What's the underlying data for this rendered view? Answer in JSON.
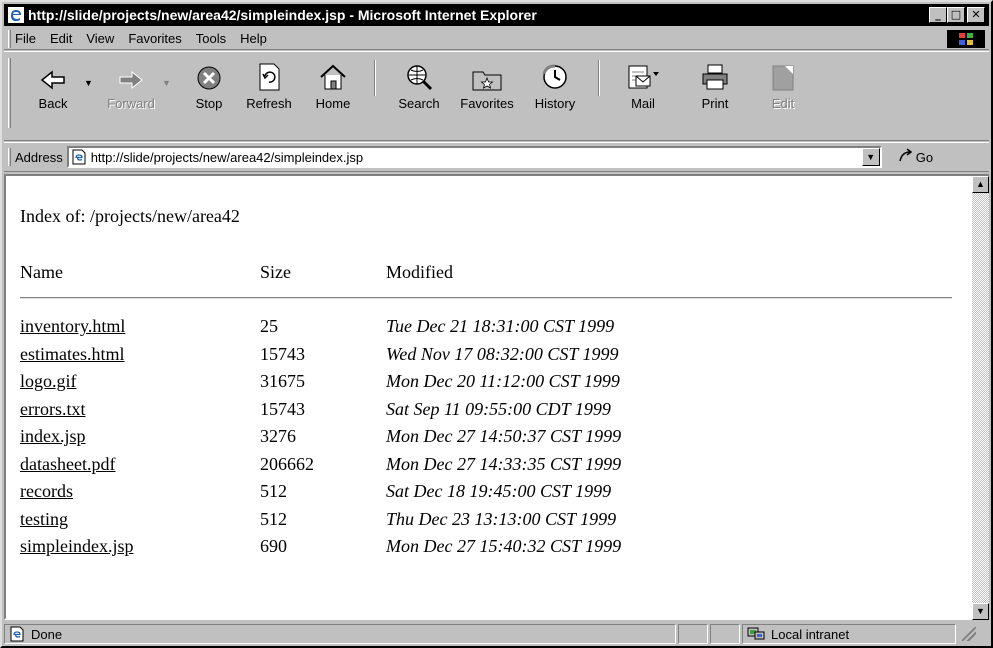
{
  "window": {
    "title": "http://slide/projects/new/area42/simpleindex.jsp - Microsoft Internet Explorer",
    "min_label": "_",
    "max_label": "□",
    "close_label": "✕"
  },
  "menu": {
    "file": "File",
    "edit": "Edit",
    "view": "View",
    "favorites": "Favorites",
    "tools": "Tools",
    "help": "Help"
  },
  "toolbar": {
    "back": "Back",
    "forward": "Forward",
    "stop": "Stop",
    "refresh": "Refresh",
    "home": "Home",
    "search": "Search",
    "favorites": "Favorites",
    "history": "History",
    "mail": "Mail",
    "print": "Print",
    "edit": "Edit"
  },
  "address": {
    "label": "Address",
    "url": "http://slide/projects/new/area42/simpleindex.jsp",
    "go": "Go"
  },
  "page": {
    "heading": "Index of: /projects/new/area42",
    "col_name": "Name",
    "col_size": "Size",
    "col_modified": "Modified",
    "rows": [
      {
        "name": "inventory.html",
        "size": "25",
        "modified": "Tue Dec 21 18:31:00 CST 1999"
      },
      {
        "name": "estimates.html",
        "size": "15743",
        "modified": "Wed Nov 17 08:32:00 CST 1999"
      },
      {
        "name": "logo.gif",
        "size": "31675",
        "modified": "Mon Dec 20 11:12:00 CST 1999"
      },
      {
        "name": "errors.txt",
        "size": "15743",
        "modified": "Sat Sep 11 09:55:00 CDT 1999"
      },
      {
        "name": "index.jsp",
        "size": "3276",
        "modified": "Mon Dec 27 14:50:37 CST 1999"
      },
      {
        "name": "datasheet.pdf",
        "size": "206662",
        "modified": "Mon Dec 27 14:33:35 CST 1999"
      },
      {
        "name": "records",
        "size": "512",
        "modified": "Sat Dec 18 19:45:00 CST 1999"
      },
      {
        "name": "testing",
        "size": "512",
        "modified": "Thu Dec 23 13:13:00 CST 1999"
      },
      {
        "name": "simpleindex.jsp",
        "size": "690",
        "modified": "Mon Dec 27 15:40:32 CST 1999"
      }
    ]
  },
  "status": {
    "text": "Done",
    "zone": "Local intranet"
  }
}
